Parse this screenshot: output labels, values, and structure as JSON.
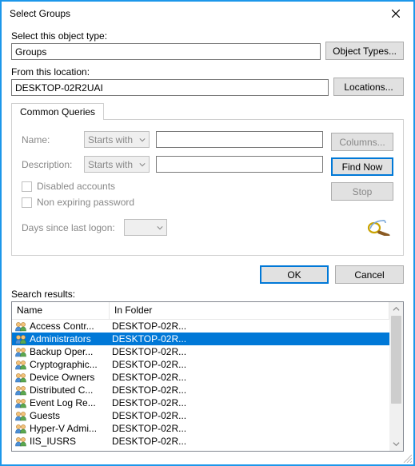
{
  "window": {
    "title": "Select Groups"
  },
  "object_type": {
    "label": "Select this object type:",
    "value": "Groups",
    "button": "Object Types..."
  },
  "location": {
    "label": "From this location:",
    "value": "DESKTOP-02R2UAI",
    "button": "Locations..."
  },
  "tab_label": "Common Queries",
  "queries": {
    "name_label": "Name:",
    "name_combo": "Starts with",
    "desc_label": "Description:",
    "desc_combo": "Starts with",
    "disabled_accounts": "Disabled accounts",
    "non_expiring": "Non expiring password",
    "days_label": "Days since last logon:"
  },
  "side": {
    "columns": "Columns...",
    "find_now": "Find Now",
    "stop": "Stop"
  },
  "ok": "OK",
  "cancel": "Cancel",
  "results_label": "Search results:",
  "columns": {
    "name": "Name",
    "folder": "In Folder"
  },
  "rows": [
    {
      "name": "Access Contr...",
      "folder": "DESKTOP-02R..."
    },
    {
      "name": "Administrators",
      "folder": "DESKTOP-02R..."
    },
    {
      "name": "Backup Oper...",
      "folder": "DESKTOP-02R..."
    },
    {
      "name": "Cryptographic...",
      "folder": "DESKTOP-02R..."
    },
    {
      "name": "Device Owners",
      "folder": "DESKTOP-02R..."
    },
    {
      "name": "Distributed C...",
      "folder": "DESKTOP-02R..."
    },
    {
      "name": "Event Log Re...",
      "folder": "DESKTOP-02R..."
    },
    {
      "name": "Guests",
      "folder": "DESKTOP-02R..."
    },
    {
      "name": "Hyper-V Admi...",
      "folder": "DESKTOP-02R..."
    },
    {
      "name": "IIS_IUSRS",
      "folder": "DESKTOP-02R..."
    }
  ],
  "selected_index": 1
}
